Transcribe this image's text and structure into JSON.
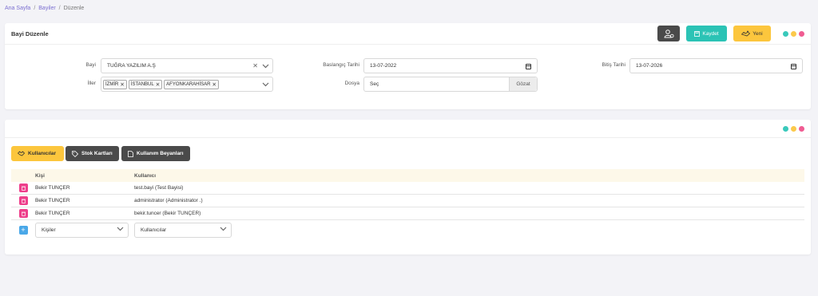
{
  "breadcrumb": {
    "home": "Ana Sayfa",
    "dealers": "Bayiler",
    "current": "Düzenle"
  },
  "form_card": {
    "title": "Bayi Düzenle",
    "buttons": {
      "save": "Kaydet",
      "new": "Yeni"
    },
    "fields": {
      "dealer_label": "Bayi",
      "dealer_value": "TUĞRA YAZILIM A.Ş",
      "cities_label": "İller",
      "cities": [
        "İZMİR",
        "İSTANBUL",
        "AFYONKARAHİSAR"
      ],
      "start_date_label": "Baslangıç Tarihi",
      "start_date_value": "13-07-2022",
      "file_label": "Dosya",
      "file_value": "Seç",
      "file_browse": "Gözat",
      "end_date_label": "Bitiş Tarihi",
      "end_date_value": "13-07-2026"
    }
  },
  "window_dots": [
    "#39c9bb",
    "#fbc94b",
    "#f05c92"
  ],
  "detail_card": {
    "tabs": {
      "users": "Kullanıcılar",
      "stock": "Stok Kartları",
      "usage": "Kullanım Beyanları"
    },
    "table": {
      "headers": {
        "person": "Kişi",
        "user": "Kullanıcı"
      },
      "rows": [
        {
          "person": "Bekir TUNÇER",
          "user": "test.bayi (Test Bayisi)"
        },
        {
          "person": "Bekir TUNÇER",
          "user": "administrator (Administrator .)"
        },
        {
          "person": "Bekir TUNÇER",
          "user": "bekir.tuncer (Bekir TUNÇER)"
        }
      ],
      "add_person_placeholder": "Kişiler",
      "add_user_placeholder": "Kullanıcılar"
    }
  },
  "colors": {
    "accent": "#7b6fd1",
    "save": "#2bc3b5",
    "new": "#fcc63d",
    "dark": "#4a4a4a",
    "delete": "#ee3f8b",
    "add": "#4aa8e8"
  }
}
